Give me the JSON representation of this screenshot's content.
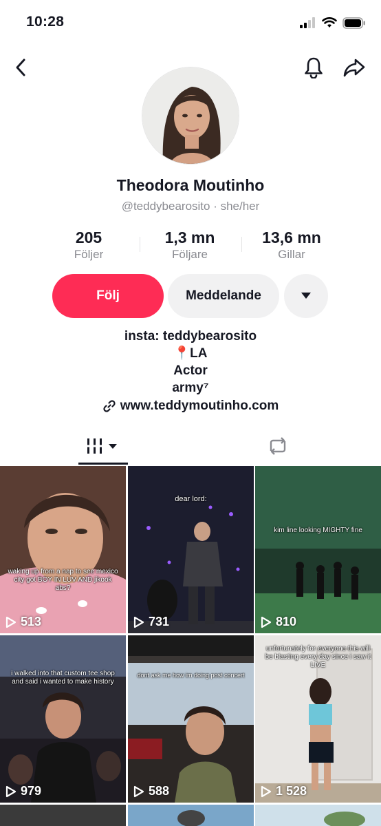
{
  "status_bar": {
    "time": "10:28"
  },
  "profile": {
    "name": "Theodora Moutinho",
    "handle": "@teddybearosito · she/her"
  },
  "stats": [
    {
      "value": "205",
      "label": "Följer"
    },
    {
      "value": "1,3 mn",
      "label": "Följare"
    },
    {
      "value": "13,6 mn",
      "label": "Gillar"
    }
  ],
  "actions": {
    "follow": "Följ",
    "message": "Meddelande"
  },
  "bio": {
    "line1": "insta: teddybearosito",
    "line2": "📍LA",
    "line3": "Actor",
    "line4": "army⁷",
    "link": "www.teddymoutinho.com"
  },
  "videos": [
    {
      "views": "513",
      "caption": "waking up from a nap to see mexico city got BOY IN LUV AND jikook abs?"
    },
    {
      "views": "731",
      "caption": "dear lord:"
    },
    {
      "views": "810",
      "caption": "kim line looking MIGHTY fine"
    },
    {
      "views": "979",
      "caption": "i walked into that custom tee shop and said i wanted to make history"
    },
    {
      "views": "588",
      "caption": "dont ask me how im doing post concert"
    },
    {
      "views": "1 528",
      "caption": "unfortunately for everyone this will be blasting every day since i saw it LIVE"
    }
  ],
  "colors": {
    "accent": "#fe2c55",
    "text": "#161823",
    "secondary": "#8a8b91"
  }
}
